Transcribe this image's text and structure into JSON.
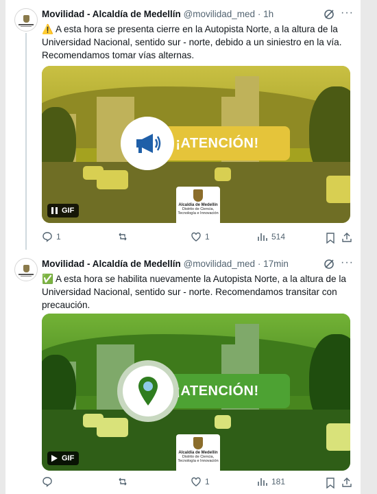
{
  "tweets": [
    {
      "author": "Movilidad - Alcaldía de Medellín",
      "handle": "@movilidad_med",
      "dot": "·",
      "time": "1h",
      "more": "···",
      "status_emoji": "⚠️",
      "text": "A esta hora se presenta cierre en la Autopista Norte, a la altura de la Universidad Nacional, sentido sur - norte, debido a un siniestro en la vía. Recomendamos tomar vías alternas.",
      "media": {
        "banner": "¡ATENCIÓN!",
        "logo_name": "Alcaldía de Medellín",
        "logo_sub": "Distrito de Ciencia, Tecnología e Innovación",
        "gif_label": "GIF",
        "gif_state": "pause-icon",
        "accent": "#e5c43a",
        "icon": "megaphone-icon"
      },
      "stats": {
        "replies": "1",
        "reposts": "",
        "likes": "1",
        "views": "514"
      }
    },
    {
      "author": "Movilidad - Alcaldía de Medellín",
      "handle": "@movilidad_med",
      "dot": "·",
      "time": "17min",
      "more": "···",
      "status_emoji": "✅",
      "text": "A esta hora se habilita nuevamente la Autopista Norte, a la altura de la Universidad Nacional, sentido sur - norte. Recomendamos transitar con precaución.",
      "media": {
        "banner": "¡ATENCIÓN!",
        "logo_name": "Alcaldía de Medellín",
        "logo_sub": "Distrito de Ciencia, Tecnología e Innovación",
        "gif_label": "GIF",
        "gif_state": "play-icon",
        "accent": "#4da233",
        "icon": "map-pin-icon"
      },
      "stats": {
        "replies": "",
        "reposts": "",
        "likes": "1",
        "views": "181"
      }
    }
  ]
}
